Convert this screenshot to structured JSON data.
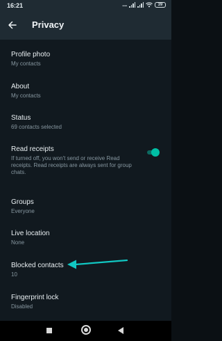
{
  "colors": {
    "toolbar_bg": "#1f2b33",
    "page_bg": "#11191f",
    "primary_text": "#e9eff2",
    "secondary_text": "#8797a0",
    "toggle_on": "#00bfa5",
    "annotation_arrow": "#11c7c2"
  },
  "status_bar": {
    "time": "16:21",
    "battery": "39",
    "icons": [
      "signal-dots-icon",
      "signal-bars-icon",
      "signal-bars-icon",
      "wifi-icon",
      "battery-icon"
    ]
  },
  "app_bar": {
    "title": "Privacy",
    "back_icon": "back-arrow-icon"
  },
  "settings": [
    {
      "title": "Profile photo",
      "subtitle": "My contacts"
    },
    {
      "title": "About",
      "subtitle": "My contacts"
    },
    {
      "title": "Status",
      "subtitle": "69 contacts selected"
    },
    {
      "title": "Read receipts",
      "subtitle": "If turned off, you won't send or receive Read receipts. Read receipts are always sent for group chats.",
      "toggle_on": true
    },
    {
      "title": "Groups",
      "subtitle": "Everyone"
    },
    {
      "title": "Live location",
      "subtitle": "None"
    },
    {
      "title": "Blocked contacts",
      "subtitle": "10"
    },
    {
      "title": "Fingerprint lock",
      "subtitle": "Disabled"
    }
  ],
  "annotation": {
    "icon": "arrow-annotation-icon",
    "points_to": "Blocked contacts"
  },
  "nav_bar": {
    "icons": [
      "recents-square-icon",
      "home-circle-icon",
      "back-triangle-icon"
    ]
  }
}
